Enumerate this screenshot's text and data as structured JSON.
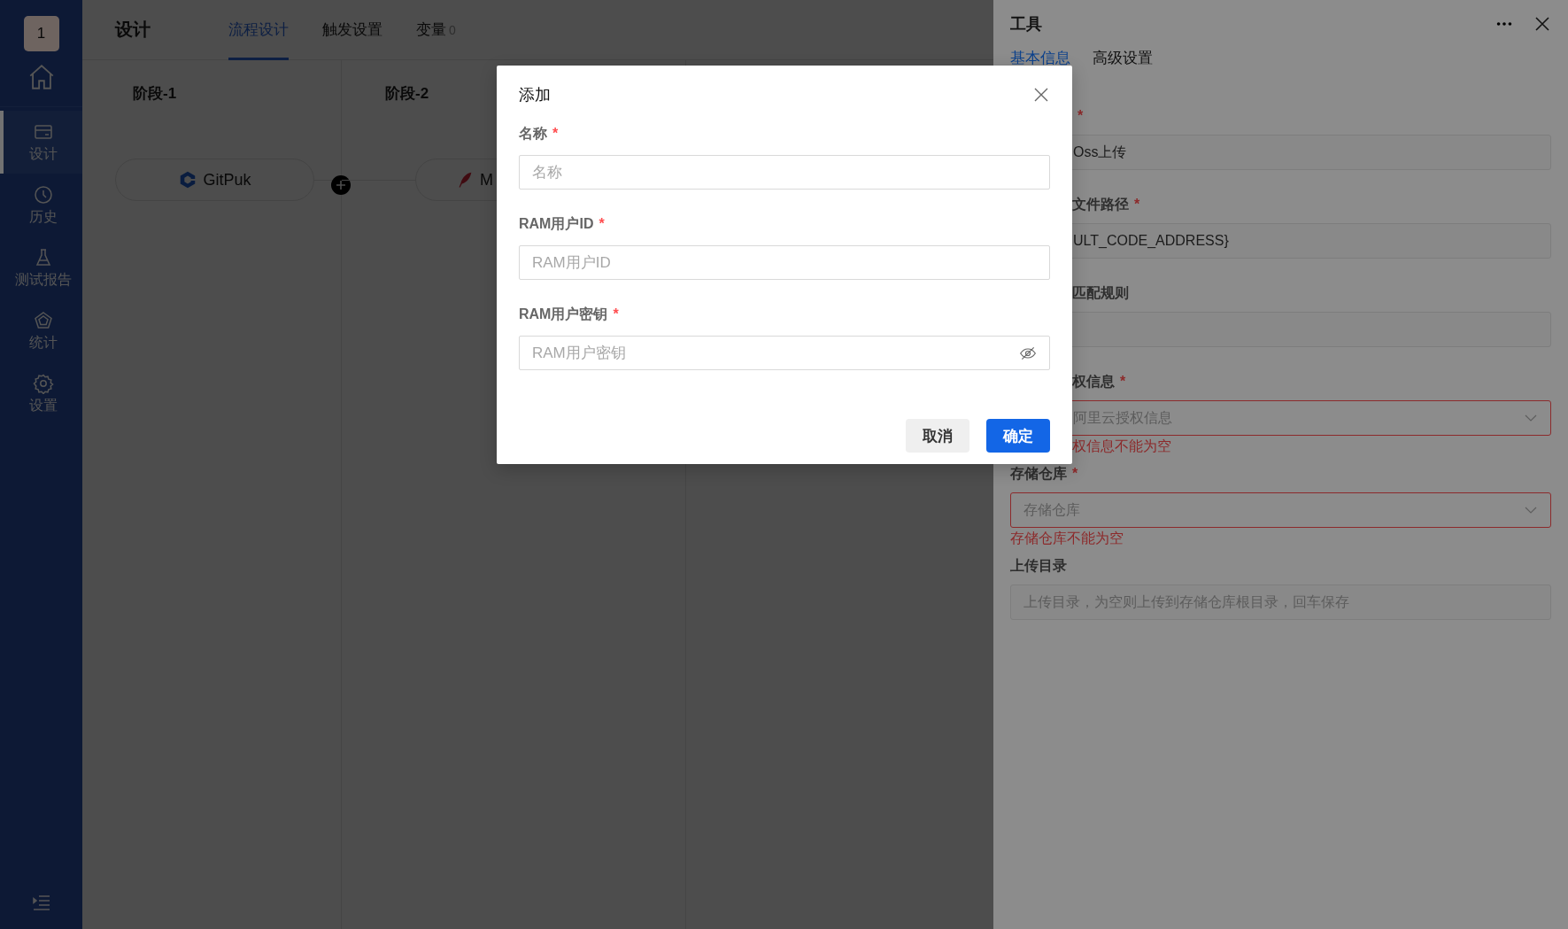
{
  "sidebar": {
    "avatar": "1",
    "items": [
      {
        "label": "设计",
        "selected": true
      },
      {
        "label": "历史",
        "selected": false
      },
      {
        "label": "测试报告",
        "selected": false
      },
      {
        "label": "统计",
        "selected": false
      },
      {
        "label": "设置",
        "selected": false
      }
    ]
  },
  "header": {
    "title": "设计",
    "tabs": [
      {
        "label": "流程设计",
        "selected": true
      },
      {
        "label": "触发设置",
        "selected": false
      },
      {
        "label": "变量",
        "count": "0",
        "selected": false
      }
    ]
  },
  "stages": [
    {
      "title": "阶段-1",
      "nodes": [
        {
          "label": "GitPuk",
          "kind": "gitpuk"
        }
      ]
    },
    {
      "title": "阶段-2",
      "nodes": [
        {
          "label": "M",
          "kind": "feather"
        }
      ]
    }
  ],
  "drawer": {
    "title": "工具",
    "tabs": [
      {
        "label": "基本信息",
        "selected": true
      },
      {
        "label": "高级设置",
        "selected": false
      }
    ],
    "fields": [
      {
        "kind": "input",
        "partly_hidden": true,
        "required_mark": "*",
        "value": "Oss上传"
      },
      {
        "kind": "input",
        "partly_hidden": true,
        "label": "文件路径",
        "required_mark": "*",
        "value": "ULT_CODE_ADDRESS}"
      },
      {
        "kind": "input",
        "partly_hidden": true,
        "label": "匹配规则"
      },
      {
        "kind": "select",
        "partly_hidden": true,
        "label": "权信息",
        "required_mark": "*",
        "placeholder": "阿里云授权信息",
        "error": "权信息不能为空"
      },
      {
        "kind": "select",
        "partly_hidden": false,
        "label": "存储仓库",
        "required_mark": "*",
        "placeholder": "存储仓库",
        "error": "存储仓库不能为空"
      },
      {
        "kind": "input",
        "partly_hidden": false,
        "label": "上传目录",
        "placeholder": "上传目录，为空则上传到存储仓库根目录，回车保存"
      }
    ]
  },
  "modal": {
    "title": "添加",
    "fields": [
      {
        "label": "名称",
        "required_mark": "*",
        "placeholder": "名称",
        "kind": "text"
      },
      {
        "label": "RAM用户ID",
        "required_mark": "*",
        "placeholder": "RAM用户ID",
        "kind": "text"
      },
      {
        "label": "RAM用户密钥",
        "required_mark": "*",
        "placeholder": "RAM用户密钥",
        "kind": "password"
      }
    ],
    "buttons": [
      {
        "label": "取消",
        "kind": "secondary"
      },
      {
        "label": "确定",
        "kind": "primary"
      }
    ]
  }
}
